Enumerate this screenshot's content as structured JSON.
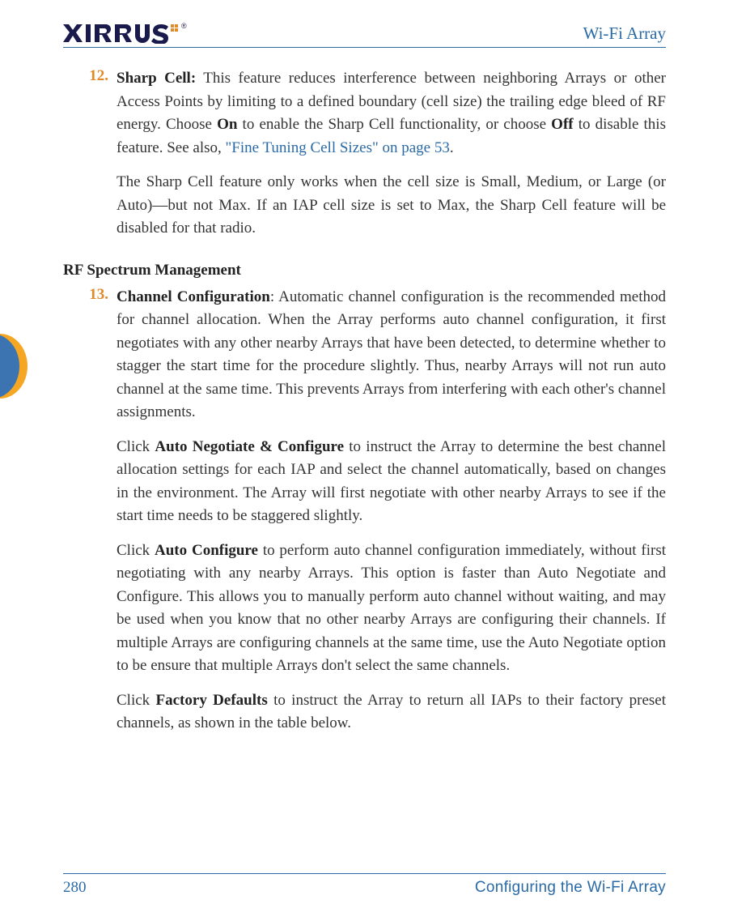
{
  "header": {
    "title": "Wi-Fi Array",
    "logo_alt": "XIRRUS"
  },
  "item12": {
    "number": "12.",
    "title": "Sharp Cell:",
    "p1_a": " This feature reduces interference between neighboring Arrays or other Access Points by limiting to a defined boundary (cell size) the trailing edge bleed of RF energy. Choose ",
    "on": "On",
    "p1_b": " to enable the Sharp Cell functionality, or choose ",
    "off": "Off",
    "p1_c": " to disable this feature. See also, ",
    "link": "\"Fine Tuning Cell Sizes\" on page 53",
    "p1_d": ".",
    "p2": "The Sharp Cell feature only works when the cell size is Small, Medium, or Large (or Auto)—but not Max. If an IAP cell size is set to Max, the Sharp Cell feature will be disabled for that radio."
  },
  "section_heading": "RF Spectrum Management",
  "item13": {
    "number": "13.",
    "title": "Channel Configuration",
    "p1": ": Automatic channel configuration is the recommended method for channel allocation. When the Array performs auto channel configuration, it first negotiates with any other nearby Arrays that have been detected, to determine whether to stagger the start time for the procedure slightly. Thus, nearby Arrays will not run auto channel at the same time. This prevents Arrays from interfering with each other's channel assignments.",
    "p2_a": "Click ",
    "auto_neg": "Auto Negotiate & Configure",
    "p2_b": " to instruct the Array to determine the best channel allocation settings for each IAP and select the channel automatically, based on changes in the environment. The Array will first negotiate with other nearby Arrays to see if the start time needs to be staggered slightly.",
    "p3_a": "Click ",
    "auto_conf": "Auto Configure",
    "p3_b": " to perform auto channel configuration immediately, without first negotiating with any nearby Arrays. This option is faster than Auto Negotiate and Configure. This allows you to manually perform auto channel without waiting, and may be used when you know that no other nearby Arrays are configuring their channels. If multiple Arrays are configuring channels at the same time, use the Auto Negotiate option to be ensure that multiple Arrays don't select the same channels.",
    "p4_a": "Click ",
    "factory": "Factory Defaults",
    "p4_b": " to instruct the Array to return all IAPs to their factory preset channels, as shown in the table below."
  },
  "footer": {
    "page": "280",
    "section": "Configuring the Wi-Fi Array"
  }
}
